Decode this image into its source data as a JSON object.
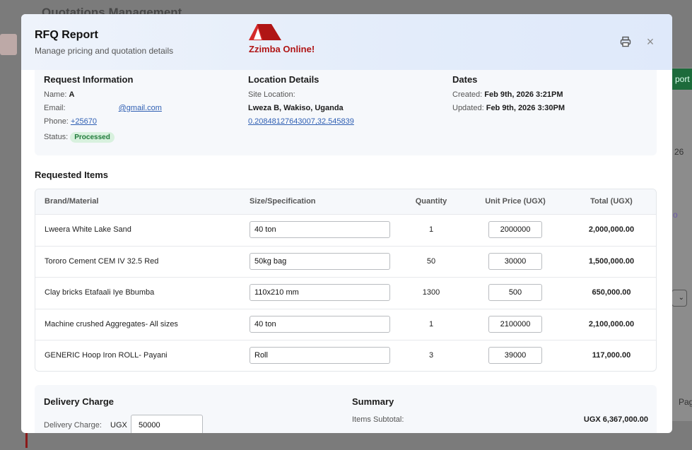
{
  "background": {
    "page_title": "Quotations Management",
    "export_button_fragment": "port R",
    "number_fragment": "26",
    "pagination_fragment": "Pag"
  },
  "modal": {
    "title": "RFQ Report",
    "subtitle": "Manage pricing and quotation details",
    "logo_text": "Zzimba Online!",
    "logo_color": "#b01515",
    "print_icon": "printer-icon",
    "close_icon": "close-icon",
    "close_glyph": "×"
  },
  "request_info": {
    "heading": "Request Information",
    "name_label": "Name:",
    "name_value": "A",
    "email_label": "Email:",
    "email_value": "@gmail.com",
    "phone_label": "Phone:",
    "phone_value": "+25670",
    "status_label": "Status:",
    "status_value": "Processed",
    "status_color": "#1f7a3a"
  },
  "location": {
    "heading": "Location Details",
    "site_label": "Site Location:",
    "site_value": "Lweza B, Wakiso, Uganda",
    "coords": "0.20848127643007,32.545839"
  },
  "dates": {
    "heading": "Dates",
    "created_label": "Created:",
    "created_value": "Feb 9th, 2026 3:21PM",
    "updated_label": "Updated:",
    "updated_value": "Feb 9th, 2026 3:30PM"
  },
  "items": {
    "heading": "Requested Items",
    "columns": [
      "Brand/Material",
      "Size/Specification",
      "Quantity",
      "Unit Price (UGX)",
      "Total (UGX)"
    ],
    "rows": [
      {
        "material": "Lweera White Lake Sand",
        "spec": "40 ton",
        "qty": "1",
        "unit_price": "2000000",
        "total": "2,000,000.00"
      },
      {
        "material": "Tororo Cement CEM IV 32.5 Red",
        "spec": "50kg bag",
        "qty": "50",
        "unit_price": "30000",
        "total": "1,500,000.00"
      },
      {
        "material": "Clay bricks Etafaali Iye Bbumba",
        "spec": "110x210 mm",
        "qty": "1300",
        "unit_price": "500",
        "total": "650,000.00"
      },
      {
        "material": "Machine crushed Aggregates- All sizes",
        "spec": "40 ton",
        "qty": "1",
        "unit_price": "2100000",
        "total": "2,100,000.00"
      },
      {
        "material": "GENERIC Hoop Iron ROLL- Payani",
        "spec": "Roll",
        "qty": "3",
        "unit_price": "39000",
        "total": "117,000.00"
      }
    ]
  },
  "delivery": {
    "heading": "Delivery Charge",
    "label": "Delivery Charge:",
    "currency": "UGX",
    "value": "50000"
  },
  "summary": {
    "heading": "Summary",
    "subtotal_label": "Items Subtotal:",
    "subtotal_value": "UGX 6,367,000.00"
  }
}
